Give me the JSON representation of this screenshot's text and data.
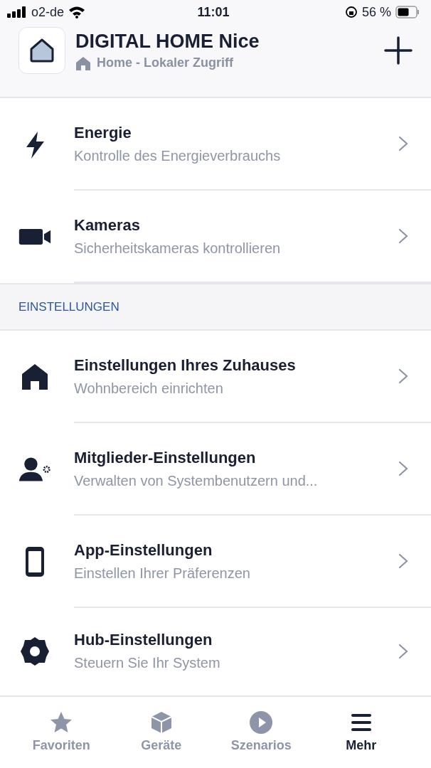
{
  "status_bar": {
    "carrier": "o2-de",
    "time": "11:01",
    "battery": "56 %"
  },
  "header": {
    "title": "DIGITAL HOME Nice",
    "subtitle": "Home - Lokaler Zugriff"
  },
  "groups": [
    {
      "items": [
        {
          "kind": "bolt",
          "title": "Energie",
          "subtitle": "Kontrolle des Energieverbrauchs"
        },
        {
          "kind": "camera",
          "title": "Kameras",
          "subtitle": "Sicherheitskameras kontrollieren"
        }
      ]
    },
    {
      "heading": "EINSTELLUNGEN",
      "items": [
        {
          "kind": "house",
          "title": "Einstellungen Ihres Zuhauses",
          "subtitle": "Wohnbereich einrichten"
        },
        {
          "kind": "user-gear",
          "title": "Mitglieder-Einstellungen",
          "subtitle": "Verwalten von Systembenutzern und..."
        },
        {
          "kind": "phone",
          "title": "App-Einstellungen",
          "subtitle": "Einstellen Ihrer Präferenzen"
        },
        {
          "kind": "gear",
          "title": "Hub-Einstellungen",
          "subtitle": "Steuern Sie Ihr System"
        }
      ]
    }
  ],
  "tabs": [
    {
      "kind": "star",
      "label": "Favoriten",
      "selected": false
    },
    {
      "kind": "cube",
      "label": "Geräte",
      "selected": false
    },
    {
      "kind": "play",
      "label": "Szenarios",
      "selected": false
    },
    {
      "kind": "menu",
      "label": "Mehr",
      "selected": true
    }
  ]
}
